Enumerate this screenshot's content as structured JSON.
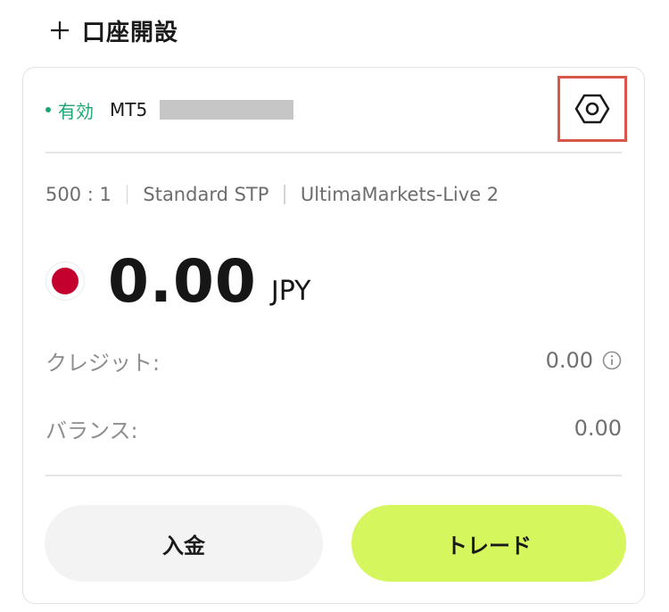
{
  "header": {
    "open_account_label": "口座開設",
    "plus_icon": "plus-icon"
  },
  "account": {
    "status_label": "有効",
    "status_color": "#1ba672",
    "platform": "MT5",
    "leverage": "500 : 1",
    "account_type": "Standard STP",
    "server": "UltimaMarkets-Live 2",
    "balance_amount": "0.00",
    "currency": "JPY",
    "currency_flag": "japan-flag-icon",
    "credit_label": "クレジット:",
    "credit_value": "0.00",
    "balance_label": "バランス:",
    "balance_value": "0.00"
  },
  "actions": {
    "deposit_label": "入金",
    "trade_label": "トレード",
    "trade_color": "#d6f65d"
  },
  "highlight_color": "#d9574a"
}
